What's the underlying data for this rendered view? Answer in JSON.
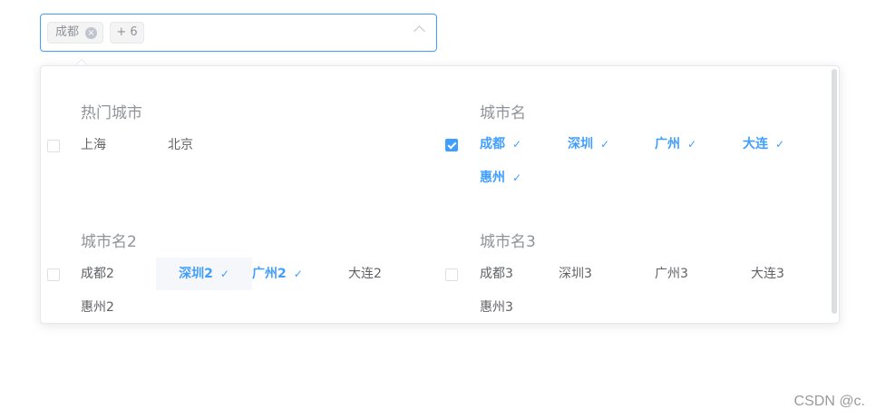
{
  "select": {
    "tags": [
      "成都",
      "+ 6"
    ],
    "tag_close_glyph": "×",
    "arrow_icon": "chevron-up-icon"
  },
  "groups": [
    {
      "title": "热门城市",
      "checked": false,
      "options": [
        {
          "label": "上海",
          "selected": false
        },
        {
          "label": "北京",
          "selected": false
        }
      ]
    },
    {
      "title": "城市名",
      "checked": true,
      "options": [
        {
          "label": "成都",
          "selected": true
        },
        {
          "label": "深圳",
          "selected": true
        },
        {
          "label": "广州",
          "selected": true
        },
        {
          "label": "大连",
          "selected": true
        },
        {
          "label": "惠州",
          "selected": true
        }
      ]
    },
    {
      "title": "城市名2",
      "checked": false,
      "options": [
        {
          "label": "成都2",
          "selected": false
        },
        {
          "label": "深圳2",
          "selected": true,
          "hover": true
        },
        {
          "label": "广州2",
          "selected": true
        },
        {
          "label": "大连2",
          "selected": false
        },
        {
          "label": "惠州2",
          "selected": false
        }
      ]
    },
    {
      "title": "城市名3",
      "checked": false,
      "options": [
        {
          "label": "成都3",
          "selected": false
        },
        {
          "label": "深圳3",
          "selected": false
        },
        {
          "label": "广州3",
          "selected": false
        },
        {
          "label": "大连3",
          "selected": false
        },
        {
          "label": "惠州3",
          "selected": false
        }
      ]
    }
  ],
  "check_glyph": "✓",
  "watermark": "CSDN @c.",
  "colors": {
    "primary": "#409eff",
    "text": "#606266",
    "muted": "#909399",
    "hover_bg": "#f5f7fa"
  }
}
